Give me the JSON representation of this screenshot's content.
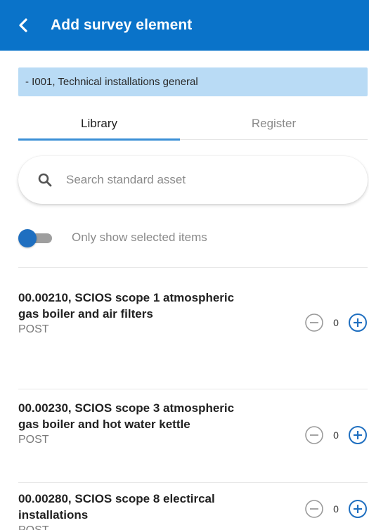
{
  "header": {
    "title": "Add survey element",
    "back_icon": "chevron-left-icon"
  },
  "context": {
    "text": "- I001, Technical installations general"
  },
  "tabs": [
    {
      "label": "Library",
      "active": true
    },
    {
      "label": "Register",
      "active": false
    }
  ],
  "search": {
    "placeholder": "Search standard asset",
    "value": ""
  },
  "filter": {
    "label": "Only show selected items",
    "enabled": true
  },
  "items": [
    {
      "title": "00.00210, SCIOS scope 1 atmospheric gas boiler and air filters",
      "subtitle": "POST",
      "count": "0"
    },
    {
      "title": "00.00230, SCIOS scope 3 atmospheric gas boiler and hot water kettle",
      "subtitle": "POST",
      "count": "0"
    },
    {
      "title": "00.00280, SCIOS scope 8 electircal installations",
      "subtitle": "POST",
      "count": "0"
    }
  ],
  "colors": {
    "primary": "#0a73c9",
    "banner": "#b9dbf5",
    "accent": "#1f6fc0"
  }
}
